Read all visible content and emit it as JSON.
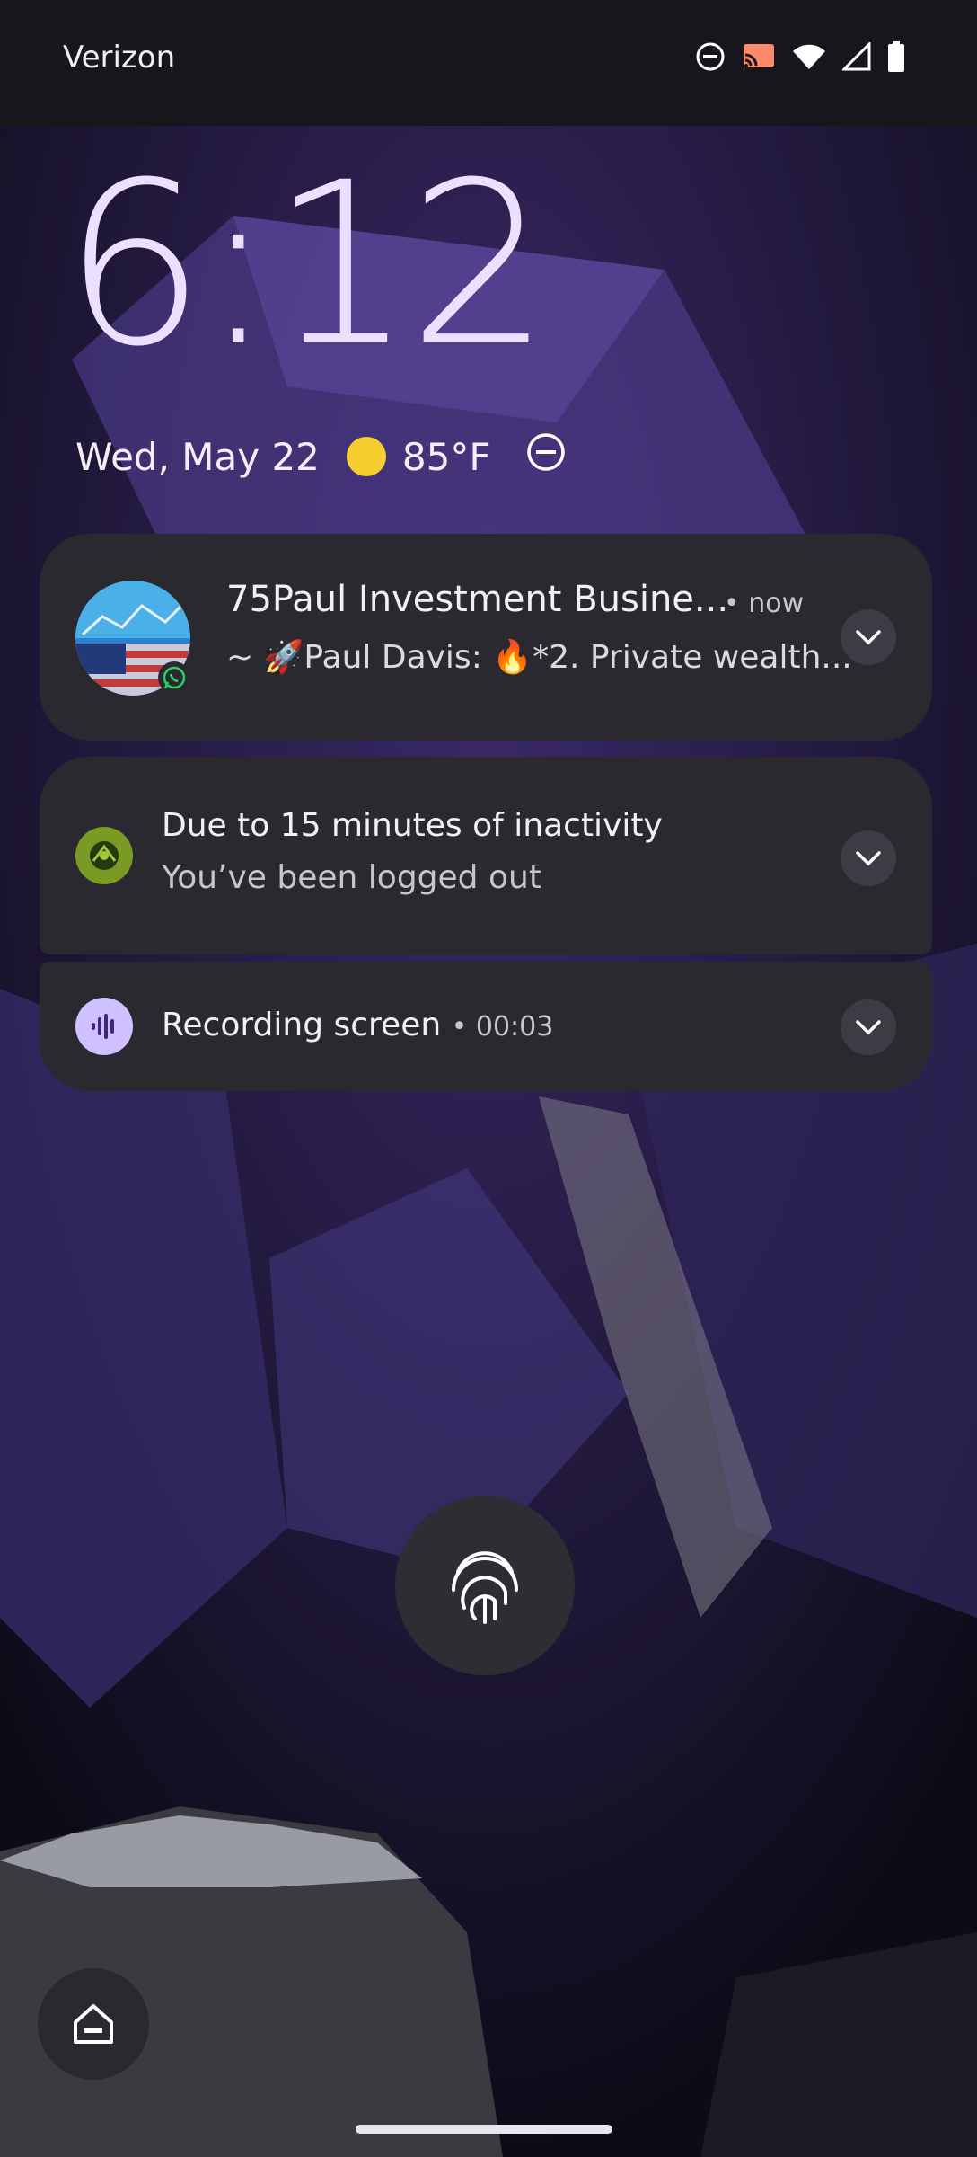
{
  "status_bar": {
    "carrier": "Verizon",
    "icons": [
      "do-not-disturb-icon",
      "cast-icon",
      "wifi-icon",
      "signal-icon",
      "battery-icon"
    ]
  },
  "lockscreen": {
    "time": "6:12",
    "date": "Wed, May 22",
    "temperature": "85°F",
    "weather_icon": "sun-icon"
  },
  "notifications": [
    {
      "app": "WhatsApp",
      "title": "75Paul Investment Busine...",
      "time": "• now",
      "text": "~ 🚀Paul Davis: 🔥*2. Private wealth..."
    },
    {
      "title": "Due to 15 minutes of inactivity",
      "text": "You’ve been logged out"
    },
    {
      "title": "Recording screen",
      "time": "• 00:03"
    }
  ],
  "colors": {
    "clock": "#e9e1ff",
    "notification_bg": "#2a2930",
    "accent_purple": "#cfc1ff",
    "sun": "#f6cf2f"
  }
}
